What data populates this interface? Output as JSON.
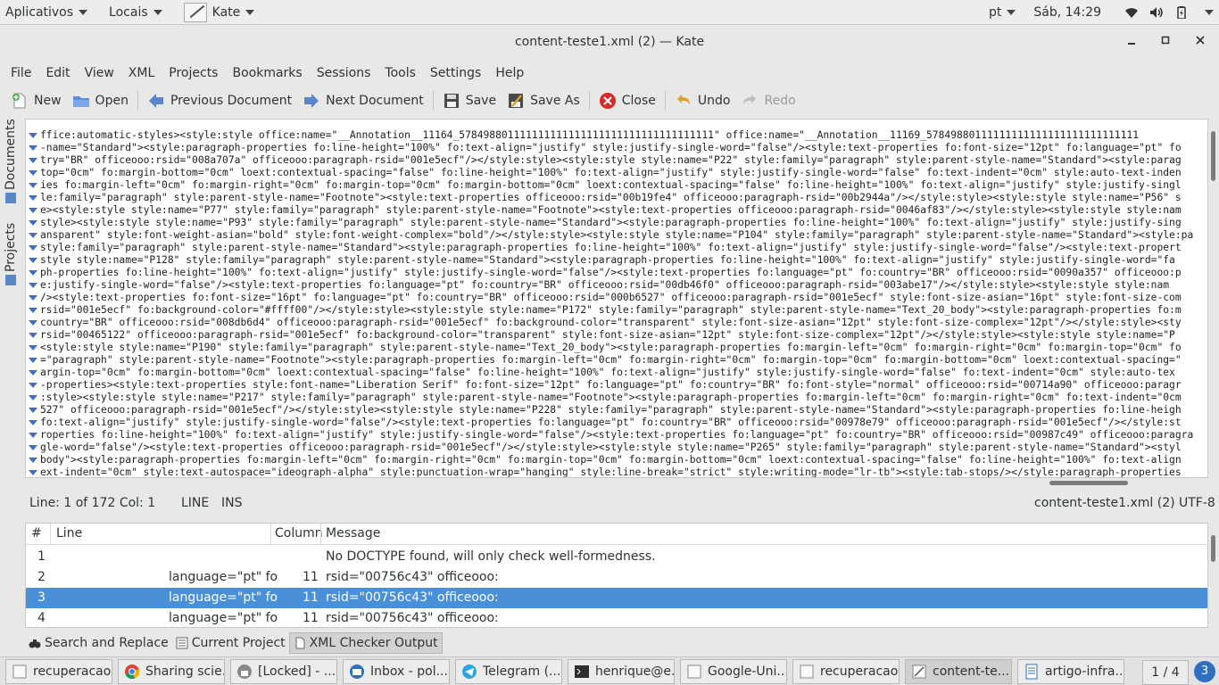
{
  "topbar": {
    "applications": "Aplicativos",
    "places": "Locais",
    "app": "Kate",
    "language": "pt",
    "clock": "Sáb, 14:29"
  },
  "window": {
    "title": "content-teste1.xml (2) — Kate"
  },
  "menubar": [
    "File",
    "Edit",
    "View",
    "XML",
    "Projects",
    "Bookmarks",
    "Sessions",
    "Tools",
    "Settings",
    "Help"
  ],
  "toolbar": {
    "new": "New",
    "open": "Open",
    "previous": "Previous Document",
    "next": "Next Document",
    "save": "Save",
    "save_as": "Save As",
    "close": "Close",
    "undo": "Undo",
    "redo": "Redo"
  },
  "sidebar": {
    "documents": "Documents",
    "projects": "Projects"
  },
  "editor": {
    "lines": [
      "ffice:automatic-styles><style:style office:name=\"__Annotation__11164_578498801111111111111111111111111111111111\" office:name=\"__Annotation__11169_57849880111111111111111111111111111",
      "-name=\"Standard\"><style:paragraph-properties fo:line-height=\"100%\" fo:text-align=\"justify\" style:justify-single-word=\"false\"/><style:text-properties fo:font-size=\"12pt\" fo:language=\"pt\" fo",
      "try=\"BR\" officeooo:rsid=\"008a707a\" officeooo:paragraph-rsid=\"001e5ecf\"/></style:style><style:style style:name=\"P22\" style:family=\"paragraph\" style:parent-style-name=\"Standard\"><style:parag",
      "top=\"0cm\" fo:margin-bottom=\"0cm\" loext:contextual-spacing=\"false\" fo:line-height=\"100%\" fo:text-align=\"justify\" style:justify-single-word=\"false\" fo:text-indent=\"0cm\" style:auto-text-inden",
      "ies fo:margin-left=\"0cm\" fo:margin-right=\"0cm\" fo:margin-top=\"0cm\" fo:margin-bottom=\"0cm\" loext:contextual-spacing=\"false\" fo:line-height=\"100%\" fo:text-align=\"justify\" style:justify-singl",
      "le:family=\"paragraph\" style:parent-style-name=\"Footnote\"><style:text-properties officeooo:rsid=\"00b19fe4\" officeooo:paragraph-rsid=\"00b2944a\"/></style:style><style:style style:name=\"P56\" s",
      "e><style:style style:name=\"P77\" style:family=\"paragraph\" style:parent-style-name=\"Footnote\"><style:text-properties officeooo:paragraph-rsid=\"0046af83\"/></style:style><style:style style:nam",
      "style><style:style style:name=\"P93\" style:family=\"paragraph\" style:parent-style-name=\"Standard\"><style:paragraph-properties fo:line-height=\"100%\" fo:text-align=\"justify\" style:justify-sing",
      "ansparent\" style:font-weight-asian=\"bold\" style:font-weight-complex=\"bold\"/></style:style><style:style style:name=\"P104\" style:family=\"paragraph\" style:parent-style-name=\"Standard\"><style:pa",
      "style:family=\"paragraph\" style:parent-style-name=\"Standard\"><style:paragraph-properties fo:line-height=\"100%\" fo:text-align=\"justify\" style:justify-single-word=\"false\"/><style:text-propert",
      "style style:name=\"P128\" style:family=\"paragraph\" style:parent-style-name=\"Standard\"><style:paragraph-properties fo:line-height=\"100%\" fo:text-align=\"justify\" style:justify-single-word=\"fa",
      "ph-properties fo:line-height=\"100%\" fo:text-align=\"justify\" style:justify-single-word=\"false\"/><style:text-properties fo:language=\"pt\" fo:country=\"BR\" officeooo:rsid=\"0090a357\" officeooo:p",
      "e:justify-single-word=\"false\"/><style:text-properties fo:language=\"pt\" fo:country=\"BR\" officeooo:rsid=\"00db46f0\" officeooo:paragraph-rsid=\"003abe17\"/></style:style><style:style style:nam",
      "/><style:text-properties fo:font-size=\"16pt\" fo:language=\"pt\" fo:country=\"BR\" officeooo:rsid=\"000b6527\" officeooo:paragraph-rsid=\"001e5ecf\" style:font-size-asian=\"16pt\" style:font-size-com",
      "rsid=\"001e5ecf\" fo:background-color=\"#ffff00\"/></style:style><style:style style:name=\"P172\" style:family=\"paragraph\" style:parent-style-name=\"Text_20_body\"><style:paragraph-properties fo:m",
      "country=\"BR\" officeooo:rsid=\"008db6d4\" officeooo:paragraph-rsid=\"001e5ecf\" fo:background-color=\"transparent\" style:font-size-asian=\"12pt\" style:font-size-complex=\"12pt\"/></style:style><sty",
      "rsid=\"00465122\" officeooo:paragraph-rsid=\"001e5ecf\" fo:background-color=\"transparent\" style:font-size-asian=\"12pt\" style:font-size-complex=\"12pt\"/></style:style><style:style style:name=\"P",
      "<style:style style:name=\"P190\" style:family=\"paragraph\" style:parent-style-name=\"Text_20_body\"><style:paragraph-properties fo:margin-left=\"0cm\" fo:margin-right=\"0cm\" fo:margin-top=\"0cm\" fo",
      "=\"paragraph\" style:parent-style-name=\"Footnote\"><style:paragraph-properties fo:margin-left=\"0cm\" fo:margin-right=\"0cm\" fo:margin-top=\"0cm\" fo:margin-bottom=\"0cm\" loext:contextual-spacing=\"",
      "argin-top=\"0cm\" fo:margin-bottom=\"0cm\" loext:contextual-spacing=\"false\" fo:line-height=\"100%\" fo:text-align=\"justify\" style:justify-single-word=\"false\" fo:text-indent=\"0cm\" style:auto-tex",
      "-properties><style:text-properties style:font-name=\"Liberation Serif\" fo:font-size=\"12pt\" fo:language=\"pt\" fo:country=\"BR\" fo:font-style=\"normal\" officeooo:rsid=\"00714a90\" officeooo:paragr",
      ":style><style:style style:name=\"P217\" style:family=\"paragraph\" style:parent-style-name=\"Footnote\"><style:paragraph-properties fo:margin-left=\"0cm\" fo:margin-right=\"0cm\" fo:text-indent=\"0cm",
      "527\" officeooo:paragraph-rsid=\"001e5ecf\"/></style:style><style:style style:name=\"P228\" style:family=\"paragraph\" style:parent-style-name=\"Standard\"><style:paragraph-properties fo:line-heigh",
      "fo:text-align=\"justify\" style:justify-single-word=\"false\"/><style:text-properties fo:language=\"pt\" fo:country=\"BR\" officeooo:rsid=\"00978e79\" officeooo:paragraph-rsid=\"001e5ecf\"/></style:st",
      "roperties fo:line-height=\"100%\" fo:text-align=\"justify\" style:justify-single-word=\"false\"/><style:text-properties fo:language=\"pt\" fo:country=\"BR\" officeooo:rsid=\"00987c49\" officeooo:paragra",
      "gle-word=\"false\"/><style:text-properties officeooo:paragraph-rsid=\"001e5ecf\"/></style:style><style:style style:name=\"P265\" style:family=\"paragraph\" style:parent-style-name=\"Standard\"><styl",
      "body\"><style:paragraph-properties fo:margin-left=\"0cm\" fo:margin-right=\"0cm\" fo:margin-top=\"0cm\" fo:margin-bottom=\"0cm\" loext:contextual-spacing=\"false\" fo:line-height=\"100%\" fo:text-align",
      "ext-indent=\"0cm\" style:text-autospace=\"ideograph-alpha\" style:punctuation-wrap=\"hanging\" style:line-break=\"strict\" style:writing-mode=\"lr-tb\"><style:tab-stops/></style:paragraph-properties"
    ]
  },
  "status": {
    "position": "Line: 1 of 172 Col: 1",
    "mode": "LINE",
    "input": "INS",
    "file": "content-teste1.xml (2)",
    "encoding": "UTF-8"
  },
  "output": {
    "headers": [
      "#",
      "Line",
      "Column",
      "Message"
    ],
    "rows": [
      {
        "num": "1",
        "line": "",
        "column": "",
        "message": "No DOCTYPE found, will only check well-formedness."
      },
      {
        "num": "2",
        "line": "language=\"pt\" fo",
        "column": "11",
        "message": "rsid=\"00756c43\" officeooo:"
      },
      {
        "num": "3",
        "line": "language=\"pt\" fo",
        "column": "11",
        "message": "rsid=\"00756c43\" officeooo:"
      },
      {
        "num": "4",
        "line": "language=\"pt\" fo",
        "column": "11",
        "message": "rsid=\"00756c43\" officeooo:"
      }
    ]
  },
  "tooltabs": {
    "search": "Search and Replace",
    "project": "Current Project",
    "xml": "XML Checker Output"
  },
  "taskbar": {
    "tasks": [
      "recuperacao",
      "Sharing scie...",
      "[Locked] - ...",
      "Inbox - pol...",
      "Telegram (...",
      "henrique@e...",
      "Google-Uni...",
      "recuperacao",
      "content-te...",
      "artigo-infra..."
    ],
    "pager": "1 / 4",
    "notifications": "3"
  }
}
